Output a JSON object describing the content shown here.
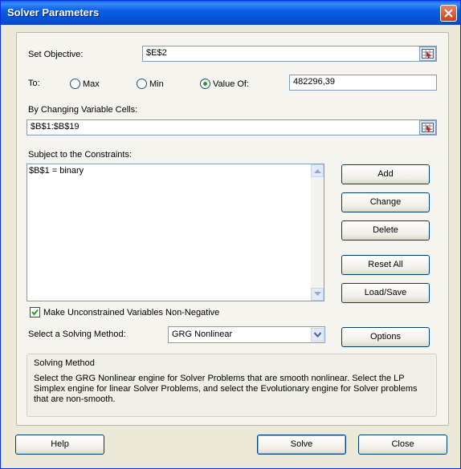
{
  "window": {
    "title": "Solver Parameters"
  },
  "objective": {
    "label": "Set Objective:",
    "value": "$E$2"
  },
  "to": {
    "label": "To:",
    "max_label": "Max",
    "min_label": "Min",
    "value_of_label": "Value Of:",
    "selected": "value_of",
    "value_of_value": "482296,39"
  },
  "changing": {
    "label": "By Changing Variable Cells:",
    "value": "$B$1:$B$19"
  },
  "constraints": {
    "label": "Subject to the Constraints:",
    "items": [
      "$B$1 = binary"
    ]
  },
  "side_buttons": {
    "add": "Add",
    "change": "Change",
    "delete": "Delete",
    "reset_all": "Reset All",
    "load_save": "Load/Save",
    "options": "Options"
  },
  "nonneg": {
    "label": "Make Unconstrained Variables Non-Negative",
    "checked": true
  },
  "method": {
    "label": "Select a Solving Method:",
    "value": "GRG Nonlinear"
  },
  "solving_method": {
    "title": "Solving Method",
    "description": "Select the GRG Nonlinear engine for Solver Problems that are smooth nonlinear. Select the LP Simplex engine for linear Solver Problems, and select the Evolutionary engine for Solver problems that are non-smooth."
  },
  "footer": {
    "help": "Help",
    "solve": "Solve",
    "close": "Close"
  },
  "icons": {
    "close": "close-icon",
    "range_picker": "range-picker-icon",
    "scroll_up": "scroll-up-icon",
    "scroll_down": "scroll-down-icon",
    "dropdown": "chevron-down-icon",
    "check": "check-icon"
  },
  "colors": {
    "titlebar": "#0a5ee8",
    "close_button": "#c8401c",
    "dialog_bg": "#ece9d8",
    "radio_dot": "#21a121"
  }
}
